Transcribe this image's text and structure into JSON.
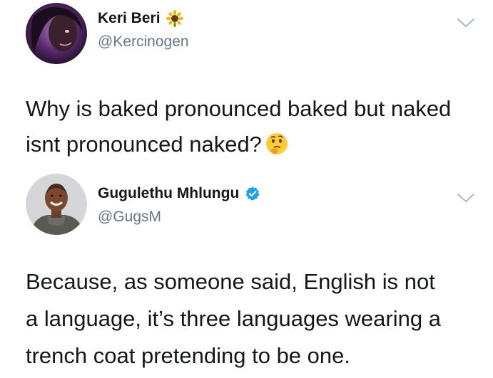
{
  "tweets": [
    {
      "author": {
        "display_name": "Keri Beri",
        "handle": "@Kercinogen",
        "badge": "sunflower-emoji"
      },
      "text": "Why is baked pronounced baked but naked isnt pronounced naked?",
      "emoji": "thinking-face-emoji"
    },
    {
      "author": {
        "display_name": "Gugulethu Mhlungu",
        "handle": "@GugsM",
        "badge": "verified-icon"
      },
      "text_lines": [
        "Because, as someone said, English is not",
        "a language, it’s three languages wearing a",
        "trench coat pretending to be one."
      ]
    }
  ],
  "colors": {
    "text": "#14171a",
    "secondary_text": "#657786",
    "verified_blue": "#1da1f2",
    "chevron": "#aab8c2"
  }
}
